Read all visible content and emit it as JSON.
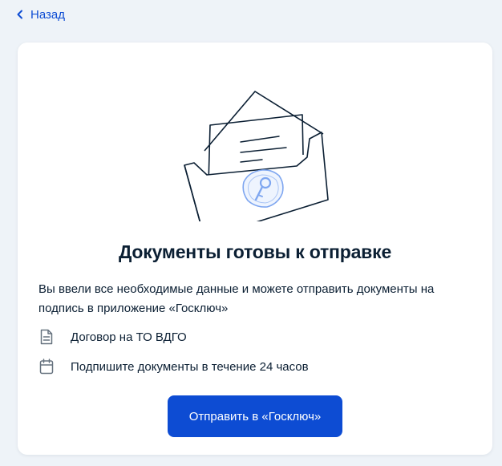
{
  "nav": {
    "back_label": "Назад"
  },
  "card": {
    "title": "Документы готовы к отправке",
    "description": "Вы ввели все необходимые данные и можете отправить документы на подпись в приложение «Госключ»",
    "items": [
      {
        "icon": "document-icon",
        "label": "Договор на ТО ВДГО"
      },
      {
        "icon": "calendar-icon",
        "label": "Подпишите документы в течение 24 часов"
      }
    ],
    "submit_label": "Отправить в «Госключ»"
  },
  "colors": {
    "accent": "#0d4cd3",
    "page_background": "#eef3f8",
    "card_background": "#ffffff",
    "text": "#0b1f33",
    "seal": "#7ea6f0"
  }
}
